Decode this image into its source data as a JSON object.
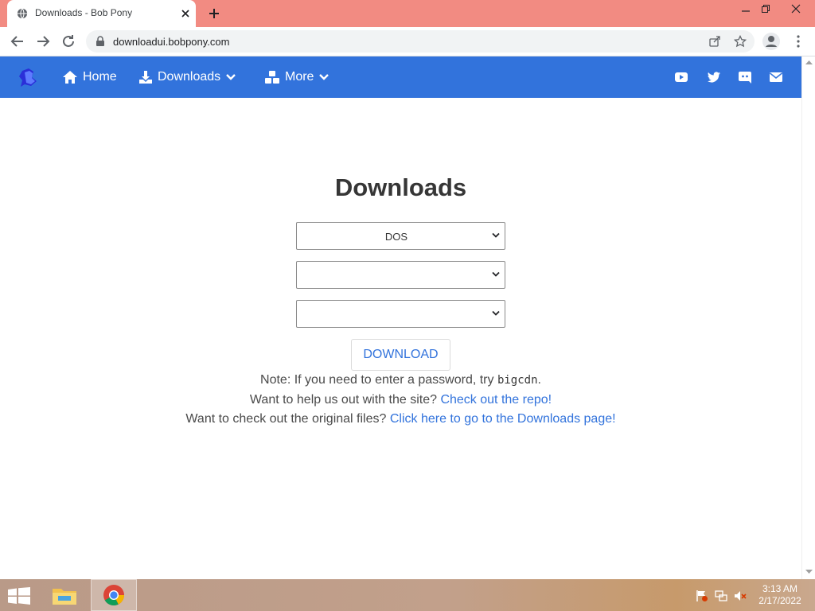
{
  "browser": {
    "tab_title": "Downloads - Bob Pony",
    "url": "downloadui.bobpony.com"
  },
  "navbar": {
    "items": [
      {
        "label": "Home",
        "icon": "home-icon"
      },
      {
        "label": "Downloads",
        "icon": "download-icon",
        "dropdown": true
      },
      {
        "label": "More",
        "icon": "cubes-icon",
        "dropdown": true
      }
    ],
    "social": [
      "youtube-icon",
      "twitter-icon",
      "discord-icon",
      "mail-icon"
    ]
  },
  "main": {
    "heading": "Downloads",
    "selects": [
      "DOS",
      "",
      ""
    ],
    "download_button": "DOWNLOAD",
    "note_prefix": "Note: If you need to enter a password, try ",
    "note_code": "bigcdn",
    "note_suffix": ".",
    "help_text": "Want to help us out with the site? ",
    "help_link": "Check out the repo!",
    "files_text": "Want to check out the original files? ",
    "files_link": "Click here to go to the Downloads page!"
  },
  "taskbar": {
    "time": "3:13 AM",
    "date": "2/17/2022"
  },
  "colors": {
    "navbar": "#3273dc",
    "titlebar": "#f28b82",
    "link": "#3273dc"
  }
}
